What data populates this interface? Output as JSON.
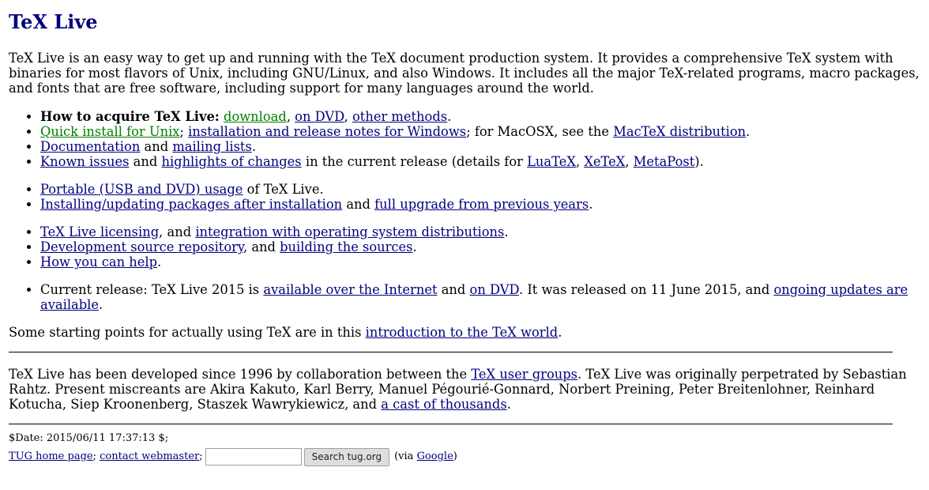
{
  "title": "TeX Live",
  "intro": "TeX Live is an easy way to get up and running with the TeX document production system. It provides a comprehensive TeX system with binaries for most flavors of Unix, including GNU/Linux, and also Windows. It includes all the major TeX-related programs, macro packages, and fonts that are free software, including support for many languages around the world.",
  "list1": {
    "acquire_label": "How to acquire TeX Live:",
    "download": "download",
    "on_dvd": "on DVD",
    "other_methods": "other methods",
    "quick_install": "Quick install for Unix",
    "windows_notes": "installation and release notes for Windows",
    "macosx_text": "; for MacOSX, see the",
    "mactex": "MacTeX distribution",
    "documentation": "Documentation",
    "and": "and",
    "mailing_lists": "mailing lists",
    "known_issues": "Known issues",
    "highlights": "highlights of changes",
    "current_details": "in the current release (details for",
    "luatex": "LuaTeX",
    "xetex": "XeTeX",
    "metapost": "MetaPost"
  },
  "list2": {
    "portable": "Portable (USB and DVD) usage",
    "portable_suffix": "of TeX Live.",
    "installing": "Installing/updating packages after installation",
    "and": "and",
    "full_upgrade": "full upgrade from previous years"
  },
  "list3": {
    "licensing": "TeX Live licensing",
    "and_text": ", and",
    "integration": "integration with operating system distributions",
    "dev_repo": "Development source repository",
    "building": "building the sources",
    "help": "How you can help"
  },
  "list4": {
    "prefix": "Current release: TeX Live 2015 is",
    "available_internet": "available over the Internet",
    "and": "and",
    "on_dvd": "on DVD",
    "released_text": ". It was released on 11 June 2015, and",
    "ongoing_updates": "ongoing updates are available"
  },
  "starting": {
    "text": "Some starting points for actually using TeX are in this",
    "link": "introduction to the TeX world"
  },
  "credits": {
    "text1": "TeX Live has been developed since 1996 by collaboration between the",
    "tex_user_groups": "TeX user groups",
    "text2": ". TeX Live was originally perpetrated by Sebastian Rahtz. Present miscreants are Akira Kakuto, Karl Berry, Manuel Pégourié-Gonnard, Norbert Preining, Peter Breitenlohner, Reinhard Kotucha, Siep Kroonenberg, Staszek Wawrykiewicz, and",
    "cast": "a cast of thousands"
  },
  "footer": {
    "date": "$Date: 2015/06/11 17:37:13 $;",
    "tug_home": "TUG home page",
    "contact": "contact webmaster",
    "search_value": "",
    "search_button": "Search tug.org",
    "via_prefix": "(via",
    "google": "Google",
    "via_suffix": ")"
  },
  "colors": {
    "heading": "#00007f",
    "link": "#00007f",
    "link_visited": "#008000"
  }
}
